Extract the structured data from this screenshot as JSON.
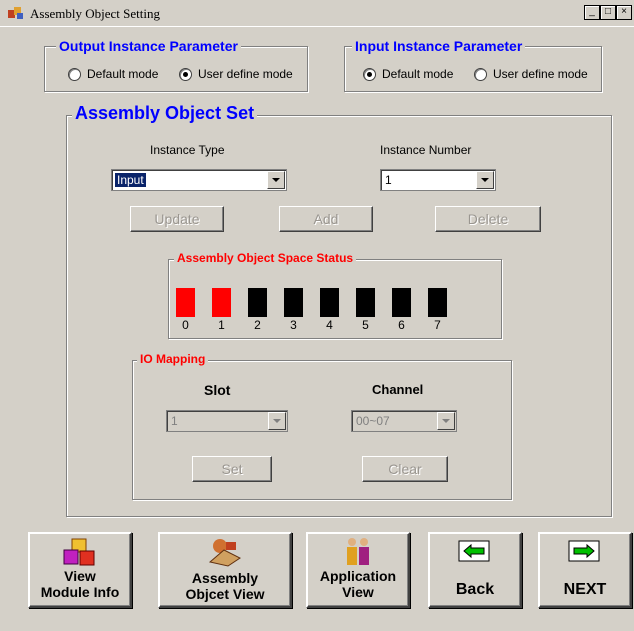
{
  "window": {
    "title": "Assembly Object Setting"
  },
  "output_group": {
    "title": "Output Instance Parameter",
    "options": [
      {
        "label": "Default mode",
        "selected": false
      },
      {
        "label": "User define mode",
        "selected": true
      }
    ]
  },
  "input_group": {
    "title": "Input Instance Parameter",
    "options": [
      {
        "label": "Default mode",
        "selected": true
      },
      {
        "label": "User define mode",
        "selected": false
      }
    ]
  },
  "assembly": {
    "title": "Assembly Object Set",
    "instance_type_label": "Instance Type",
    "instance_type_value": "Input",
    "instance_number_label": "Instance Number",
    "instance_number_value": "1",
    "update_label": "Update",
    "add_label": "Add",
    "delete_label": "Delete"
  },
  "space_status": {
    "title": "Assembly Object Space Status",
    "title_color": "#ff0000",
    "used_color": "#ff0000",
    "free_color": "#000000",
    "slots": [
      {
        "num": "0",
        "used": true
      },
      {
        "num": "1",
        "used": true
      },
      {
        "num": "2",
        "used": false
      },
      {
        "num": "3",
        "used": false
      },
      {
        "num": "4",
        "used": false
      },
      {
        "num": "5",
        "used": false
      },
      {
        "num": "6",
        "used": false
      },
      {
        "num": "7",
        "used": false
      }
    ]
  },
  "io_mapping": {
    "title": "IO Mapping",
    "slot_label": "Slot",
    "slot_value": "1",
    "channel_label": "Channel",
    "channel_value": "00~07",
    "set_label": "Set",
    "clear_label": "Clear"
  },
  "nav": {
    "view_module_info": [
      "View",
      "Module Info"
    ],
    "assembly_view": [
      "Assembly",
      "Objcet View"
    ],
    "application_view": [
      "Application",
      "View"
    ],
    "back": "Back",
    "next": "NEXT"
  },
  "accent_color": "#0000ff"
}
